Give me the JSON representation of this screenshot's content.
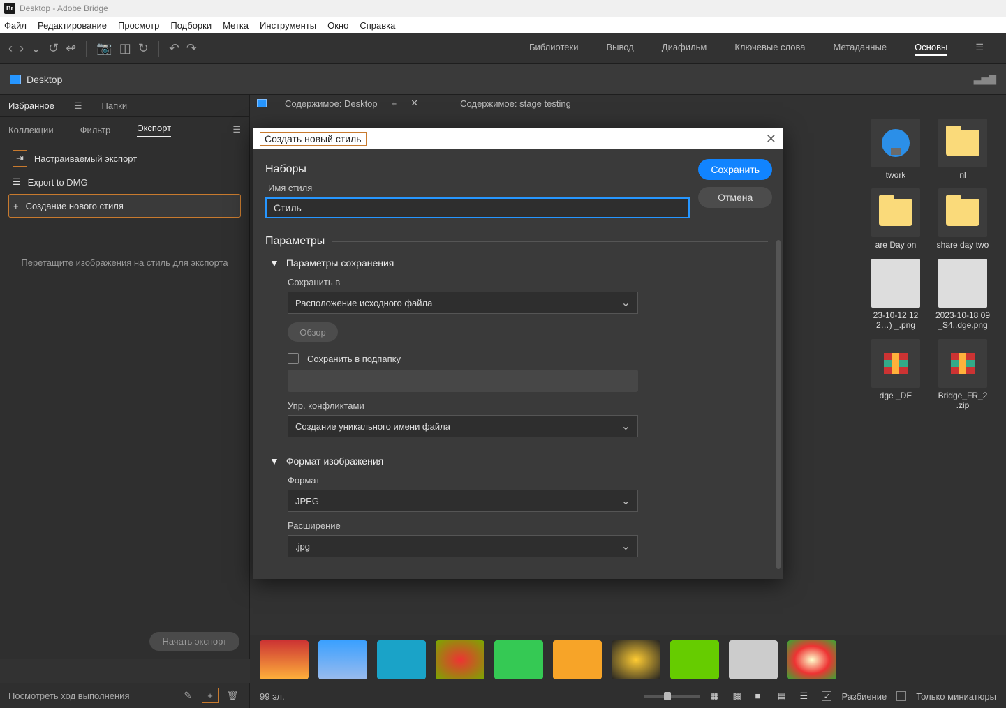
{
  "window": {
    "title": "Desktop - Adobe Bridge",
    "badge": "Br"
  },
  "menubar": [
    "Файл",
    "Редактирование",
    "Просмотр",
    "Подборки",
    "Метка",
    "Инструменты",
    "Окно",
    "Справка"
  ],
  "workspaces": {
    "items": [
      "Библиотеки",
      "Вывод",
      "Диафильм",
      "Ключевые слова",
      "Метаданные",
      "Основы"
    ],
    "active": "Основы"
  },
  "path": {
    "location": "Desktop"
  },
  "leftpanel": {
    "tabs_top": {
      "favorites": "Избранное",
      "folders": "Папки"
    },
    "tabs_mid": {
      "collections": "Коллекции",
      "filter": "Фильтр",
      "export": "Экспорт"
    },
    "export_items": {
      "custom": "Настраиваемый экспорт",
      "dmg": "Export to DMG",
      "new_style": "Создание нового стиля"
    },
    "hint": "Перетащите изображения на стиль для экспорта",
    "start_btn": "Начать экспорт",
    "progress_label": "Посмотреть ход выполнения"
  },
  "content_tabs": {
    "tab1": "Содержимое: Desktop",
    "tab2": "Содержимое: stage testing"
  },
  "files": [
    {
      "name": "twork",
      "type": "network"
    },
    {
      "name": "nl",
      "type": "folder"
    },
    {
      "name": "are Day on",
      "type": "folder"
    },
    {
      "name": "share day two",
      "type": "folder"
    },
    {
      "name": "23-10-12 12 2…) _.png",
      "type": "image"
    },
    {
      "name": "2023-10-18 09 _S4..dge.png",
      "type": "image"
    },
    {
      "name": "dge _DE",
      "type": "zip"
    },
    {
      "name": "Bridge_FR_2 .zip",
      "type": "zip"
    }
  ],
  "status": {
    "count": "99 эл.",
    "split": "Разбиение",
    "thumbs": "Только миниатюры"
  },
  "dialog": {
    "title": "Создать новый стиль",
    "save_btn": "Сохранить",
    "cancel_btn": "Отмена",
    "sections": {
      "sets": "Наборы",
      "params": "Параметры",
      "save_params": "Параметры сохранения",
      "img_format": "Формат изображения"
    },
    "fields": {
      "style_name_label": "Имя стиля",
      "style_name_value": "Стиль",
      "save_to_label": "Сохранить в",
      "save_to_value": "Расположение исходного файла",
      "browse": "Обзор",
      "save_subfolder": "Сохранить в подпапку",
      "conflict_label": "Упр. конфликтами",
      "conflict_value": "Создание уникального имени файла",
      "format_label": "Формат",
      "format_value": "JPEG",
      "ext_label": "Расширение",
      "ext_value": ".jpg"
    }
  }
}
